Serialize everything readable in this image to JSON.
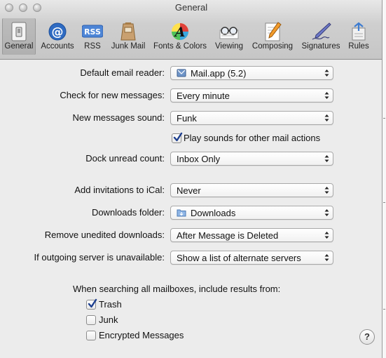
{
  "window": {
    "title": "General"
  },
  "toolbar": {
    "items": [
      {
        "label": "General",
        "icon": "light-switch-icon"
      },
      {
        "label": "Accounts",
        "icon": "at-sign-icon"
      },
      {
        "label": "RSS",
        "icon": "rss-badge-icon"
      },
      {
        "label": "Junk Mail",
        "icon": "junk-bag-icon"
      },
      {
        "label": "Fonts & Colors",
        "icon": "font-palette-icon"
      },
      {
        "label": "Viewing",
        "icon": "glasses-icon"
      },
      {
        "label": "Composing",
        "icon": "pencil-paper-icon"
      },
      {
        "label": "Signatures",
        "icon": "fountain-pen-icon"
      },
      {
        "label": "Rules",
        "icon": "rules-arrows-icon"
      }
    ],
    "selected": "General"
  },
  "settings": {
    "default_email_reader": {
      "label": "Default email reader:",
      "value": "Mail.app (5.2)"
    },
    "check_new_messages": {
      "label": "Check for new messages:",
      "value": "Every minute"
    },
    "new_messages_sound": {
      "label": "New messages sound:",
      "value": "Funk"
    },
    "play_sounds": {
      "label": "Play sounds for other mail actions",
      "checked": true
    },
    "dock_unread_count": {
      "label": "Dock unread count:",
      "value": "Inbox Only"
    },
    "add_invitations": {
      "label": "Add invitations to iCal:",
      "value": "Never"
    },
    "downloads_folder": {
      "label": "Downloads folder:",
      "value": "Downloads"
    },
    "remove_downloads": {
      "label": "Remove unedited downloads:",
      "value": "After Message is Deleted"
    },
    "outgoing_unavailable": {
      "label": "If outgoing server is unavailable:",
      "value": "Show a list of alternate servers"
    }
  },
  "search": {
    "title": "When searching all mailboxes, include results from:",
    "options": [
      {
        "label": "Trash",
        "checked": true
      },
      {
        "label": "Junk",
        "checked": false
      },
      {
        "label": "Encrypted Messages",
        "checked": false
      }
    ]
  },
  "help": {
    "label": "?"
  },
  "colors": {
    "window_bg": "#ececec",
    "checkbox_check": "#1d3f8f"
  }
}
